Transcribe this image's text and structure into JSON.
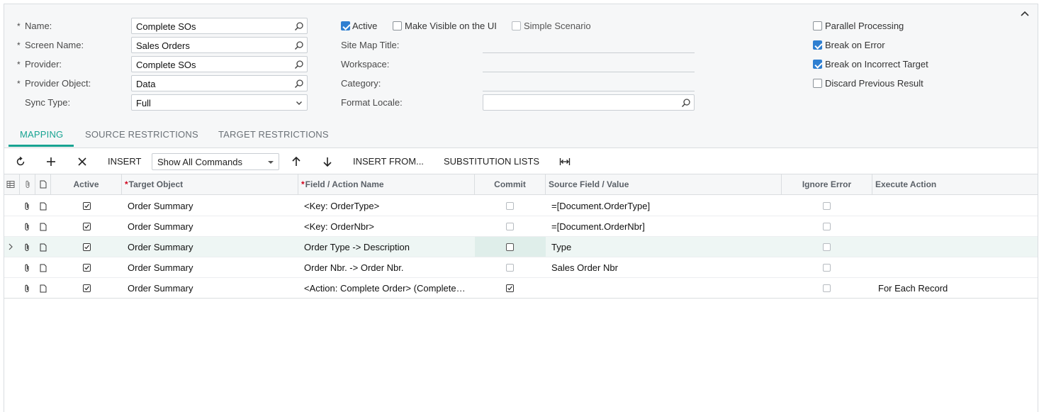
{
  "form": {
    "name_label": "Name:",
    "name_value": "Complete SOs",
    "screen_label": "Screen Name:",
    "screen_value": "Sales Orders",
    "provider_label": "Provider:",
    "provider_value": "Complete SOs",
    "provider_object_label": "Provider Object:",
    "provider_object_value": "Data",
    "sync_label": "Sync Type:",
    "sync_value": "Full",
    "active_label": "Active",
    "make_visible_label": "Make Visible on the UI",
    "simple_scenario_label": "Simple Scenario",
    "site_map_label": "Site Map Title:",
    "workspace_label": "Workspace:",
    "category_label": "Category:",
    "format_locale_label": "Format Locale:",
    "format_locale_value": "",
    "parallel_label": "Parallel Processing",
    "break_error_label": "Break on Error",
    "break_target_label": "Break on Incorrect Target",
    "discard_label": "Discard Previous Result",
    "checks": {
      "active": true,
      "make_visible": false,
      "simple_scenario": false,
      "parallel": false,
      "break_error": true,
      "break_target": true,
      "discard": false
    }
  },
  "tabs": [
    "MAPPING",
    "SOURCE RESTRICTIONS",
    "TARGET RESTRICTIONS"
  ],
  "toolbar": {
    "insert_label": "INSERT",
    "commands_select": "Show All Commands",
    "insert_from_label": "INSERT FROM...",
    "substitution_label": "SUBSTITUTION LISTS"
  },
  "grid": {
    "headers": {
      "active": "Active",
      "target_object": "Target Object",
      "field_action": "Field / Action Name",
      "commit": "Commit",
      "source_field": "Source Field / Value",
      "ignore_error": "Ignore Error",
      "execute_action": "Execute Action"
    },
    "rows": [
      {
        "active": true,
        "target_object": "Order Summary",
        "field_action": "<Key: OrderType>",
        "commit": false,
        "source_field": "=[Document.OrderType]",
        "ignore_error": false,
        "execute_action": ""
      },
      {
        "active": true,
        "target_object": "Order Summary",
        "field_action": "<Key: OrderNbr>",
        "commit": false,
        "source_field": "=[Document.OrderNbr]",
        "ignore_error": false,
        "execute_action": ""
      },
      {
        "active": true,
        "target_object": "Order Summary",
        "field_action": "Order Type -> Description",
        "commit": false,
        "source_field": "Type",
        "ignore_error": false,
        "execute_action": ""
      },
      {
        "active": true,
        "target_object": "Order Summary",
        "field_action": "Order Nbr. -> Order Nbr.",
        "commit": false,
        "source_field": "Sales Order Nbr",
        "ignore_error": false,
        "execute_action": ""
      },
      {
        "active": true,
        "target_object": "Order Summary",
        "field_action": "<Action: Complete Order> (Complete…",
        "commit": true,
        "source_field": "",
        "ignore_error": false,
        "execute_action": "For Each Record"
      }
    ]
  },
  "colors": {
    "accent": "#18a392",
    "checkbox": "#2f7fd1",
    "required": "#d0021b"
  }
}
